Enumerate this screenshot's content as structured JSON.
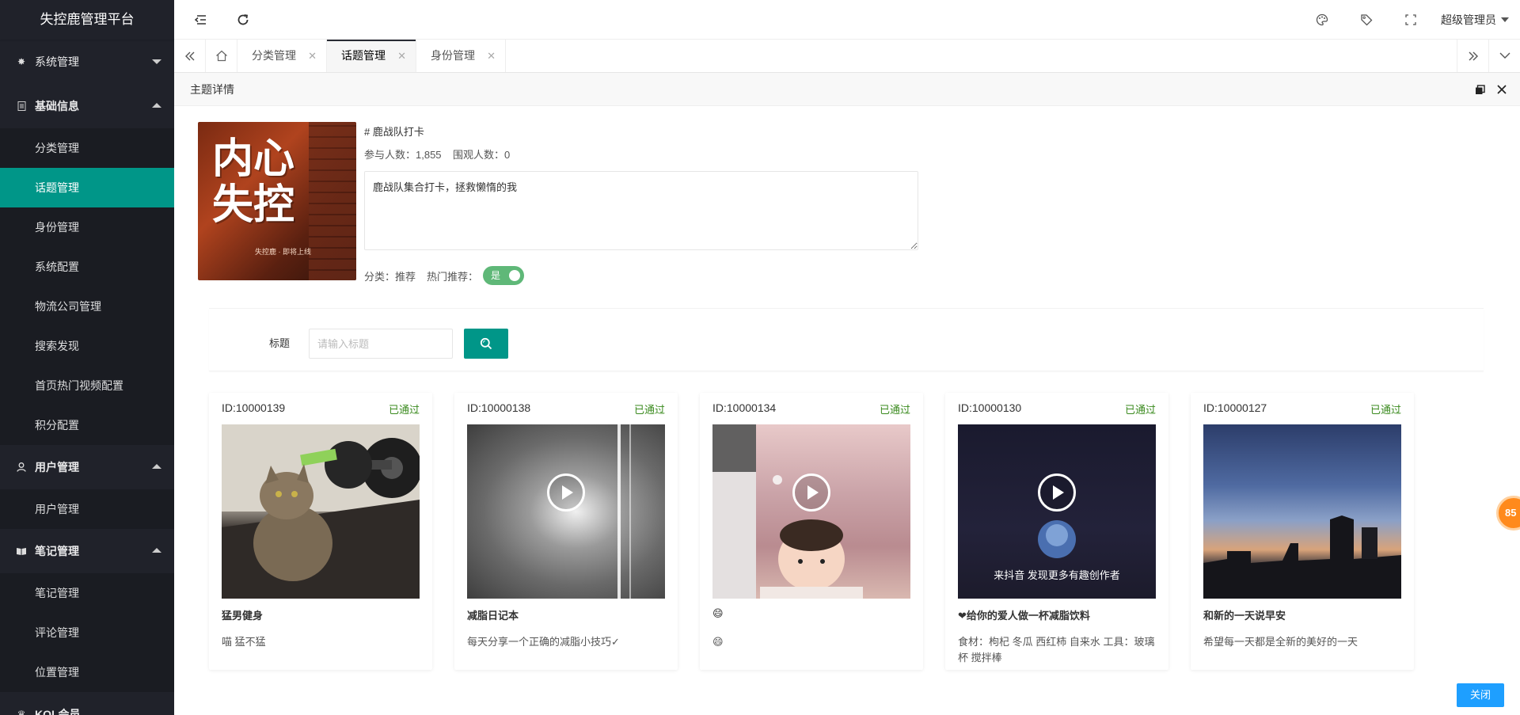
{
  "app": {
    "title": "失控鹿管理平台"
  },
  "sidebar": {
    "groups": [
      {
        "label": "系统管理",
        "icon": "gear-icon"
      },
      {
        "label": "基础信息",
        "icon": "document-icon"
      },
      {
        "label": "用户管理",
        "icon": "user-icon"
      },
      {
        "label": "笔记管理",
        "icon": "book-icon"
      },
      {
        "label": "KOL会员",
        "icon": "crown-icon"
      }
    ],
    "basic_items": [
      "分类管理",
      "话题管理",
      "身份管理",
      "系统配置",
      "物流公司管理",
      "搜索发现",
      "首页热门视频配置",
      "积分配置"
    ],
    "user_items": [
      "用户管理"
    ],
    "note_items": [
      "笔记管理",
      "评论管理",
      "位置管理"
    ]
  },
  "header": {
    "icons": [
      "menu-fold-icon",
      "refresh-icon",
      "theme-icon",
      "tag-icon",
      "fullscreen-icon"
    ],
    "user": "超级管理员"
  },
  "tabs": [
    {
      "label": "分类管理"
    },
    {
      "label": "话题管理"
    },
    {
      "label": "身份管理"
    }
  ],
  "panel": {
    "title": "主题详情",
    "topic": {
      "name": "# 鹿战队打卡",
      "stats": "参与人数：1,855    围观人数：0",
      "description": "鹿战队集合打卡，拯救懒惰的我",
      "category": "分类：推荐",
      "hot_label": "热门推荐：",
      "hot_value": "是",
      "cover_text_1": "内心",
      "cover_text_2": "失控",
      "cover_caption": "失控鹿 · 即将上线"
    },
    "search": {
      "label": "标题",
      "placeholder": "请输入标题"
    },
    "cards": [
      {
        "id": "ID:10000139",
        "status": "已通过",
        "title": "猛男健身",
        "desc": "喵 猛不猛",
        "video": false,
        "overlay": ""
      },
      {
        "id": "ID:10000138",
        "status": "已通过",
        "title": "减脂日记本",
        "desc": "每天分享一个正确的减脂小技巧✓",
        "video": true,
        "overlay": ""
      },
      {
        "id": "ID:10000134",
        "status": "已通过",
        "title": "😄",
        "desc": "😄",
        "video": true,
        "overlay": ""
      },
      {
        "id": "ID:10000130",
        "status": "已通过",
        "title": "❤给你的爱人做一杯减脂饮料",
        "desc": "食材：枸杞 冬瓜 西红柿 自来水 工具：玻璃杯 搅拌棒",
        "video": true,
        "overlay": "来抖音 发现更多有趣创作者"
      },
      {
        "id": "ID:10000127",
        "status": "已通过",
        "title": "和新的一天说早安",
        "desc": "希望每一天都是全新的美好的一天",
        "video": false,
        "overlay": ""
      }
    ],
    "badge": "85",
    "close_label": "关闭"
  },
  "colors": {
    "accent": "#009688",
    "sidebar": "#20222a",
    "primary_btn": "#1e9fff",
    "switch_on": "#5fb878",
    "status_ok": "#3a8a1e"
  }
}
